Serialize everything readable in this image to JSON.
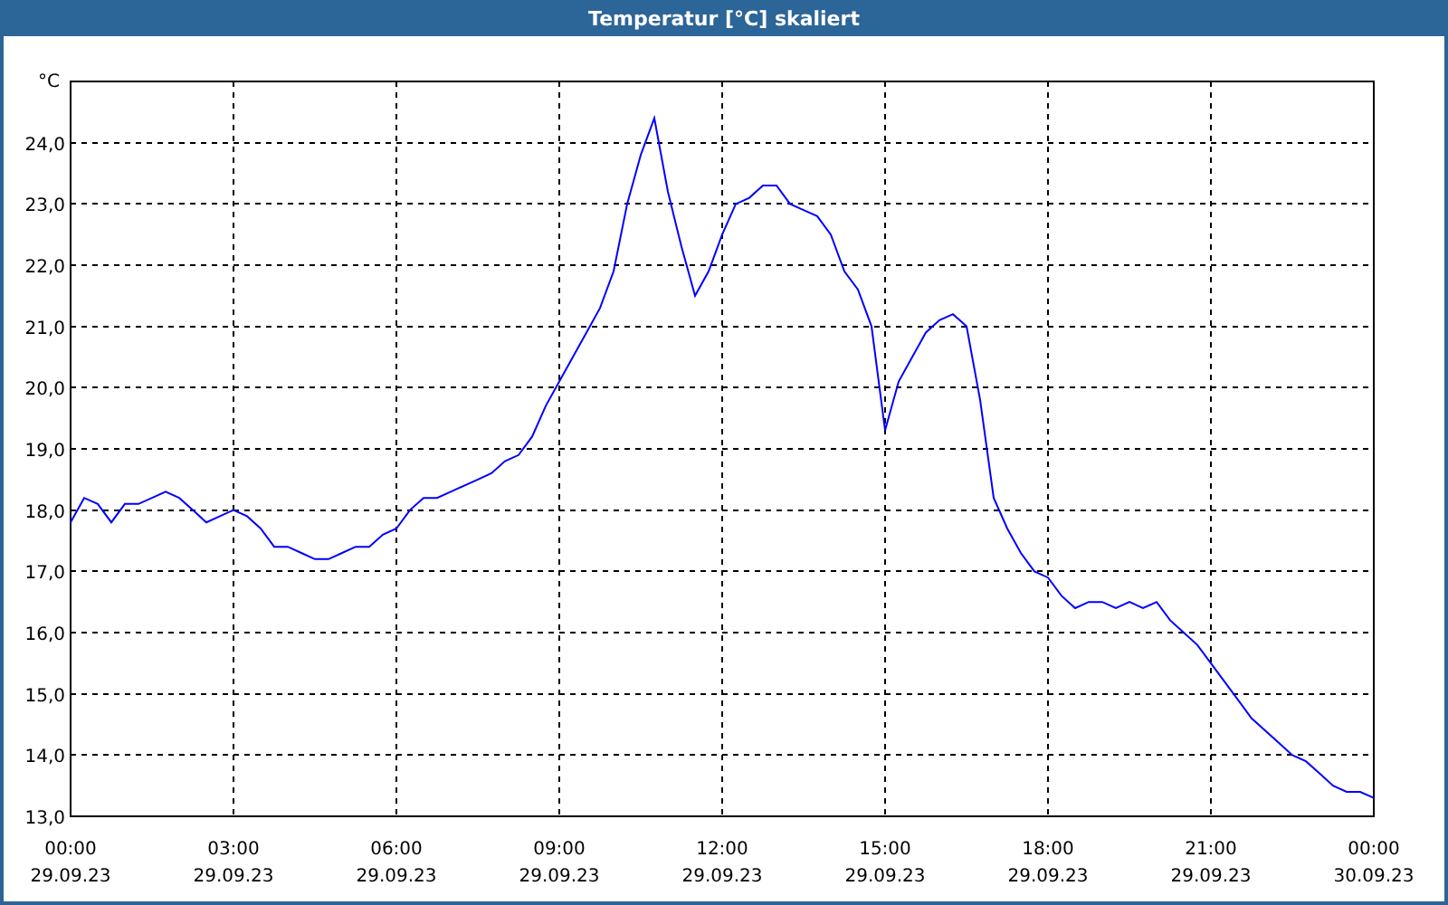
{
  "window": {
    "title": "Temperatur [°C] skaliert"
  },
  "chart": {
    "chart_data": {
      "type": "line",
      "grid": true,
      "ylabel": "°C",
      "ylim": [
        13,
        25
      ],
      "categories": [
        "00:00\n29.09.23",
        null,
        null,
        null,
        null,
        null,
        null,
        null,
        null,
        null,
        null,
        null,
        "03:00\n29.09.23",
        null,
        null,
        null,
        null,
        null,
        null,
        null,
        null,
        null,
        null,
        null,
        "06:00\n29.09.23",
        null,
        null,
        null,
        null,
        null,
        null,
        null,
        null,
        null,
        null,
        null,
        "09:00\n29.09.23",
        null,
        null,
        null,
        null,
        null,
        null,
        null,
        null,
        null,
        null,
        null,
        "12:00\n29.09.23",
        null,
        null,
        null,
        null,
        null,
        null,
        null,
        null,
        null,
        null,
        null,
        "15:00\n29.09.23",
        null,
        null,
        null,
        null,
        null,
        null,
        null,
        null,
        null,
        null,
        null,
        "18:00\n29.09.23",
        null,
        null,
        null,
        null,
        null,
        null,
        null,
        null,
        null,
        null,
        null,
        "21:00\n29.09.23",
        null,
        null,
        null,
        null,
        null,
        null,
        null,
        null,
        null,
        null,
        null,
        "00:00\n30.09.23"
      ],
      "yticks": [
        {
          "value": 13,
          "label": "13,0"
        },
        {
          "value": 14,
          "label": "14,0"
        },
        {
          "value": 15,
          "label": "15,0"
        },
        {
          "value": 16,
          "label": "16,0"
        },
        {
          "value": 17,
          "label": "17,0"
        },
        {
          "value": 18,
          "label": "18,0"
        },
        {
          "value": 19,
          "label": "19,0"
        },
        {
          "value": 20,
          "label": "20,0"
        },
        {
          "value": 21,
          "label": "21,0"
        },
        {
          "value": 22,
          "label": "22,0"
        },
        {
          "value": 23,
          "label": "23,0"
        },
        {
          "value": 24,
          "label": "24,0"
        }
      ],
      "series": [
        {
          "color": "#0000ff",
          "values": [
            17.8,
            18.2,
            18.1,
            17.8,
            18.1,
            18.1,
            18.2,
            18.3,
            18.2,
            18.0,
            17.8,
            17.9,
            18.0,
            17.9,
            17.7,
            17.4,
            17.4,
            17.3,
            17.2,
            17.2,
            17.3,
            17.4,
            17.4,
            17.6,
            17.7,
            18.0,
            18.2,
            18.2,
            18.3,
            18.4,
            18.5,
            18.6,
            18.8,
            18.9,
            19.2,
            19.7,
            20.1,
            20.5,
            20.9,
            21.3,
            21.9,
            23.0,
            23.8,
            24.4,
            23.2,
            22.3,
            21.5,
            21.9,
            22.5,
            23.0,
            23.1,
            23.3,
            23.3,
            23.0,
            22.9,
            22.8,
            22.5,
            21.9,
            21.6,
            21.0,
            19.3,
            20.1,
            20.5,
            20.9,
            21.1,
            21.2,
            21.0,
            19.8,
            18.2,
            17.7,
            17.3,
            17.0,
            16.9,
            16.6,
            16.4,
            16.5,
            16.5,
            16.4,
            16.5,
            16.4,
            16.5,
            16.2,
            16.0,
            15.8,
            15.5,
            15.2,
            14.9,
            14.6,
            14.4,
            14.2,
            14.0,
            13.9,
            13.7,
            13.5,
            13.4,
            13.4,
            13.3
          ]
        }
      ]
    }
  }
}
